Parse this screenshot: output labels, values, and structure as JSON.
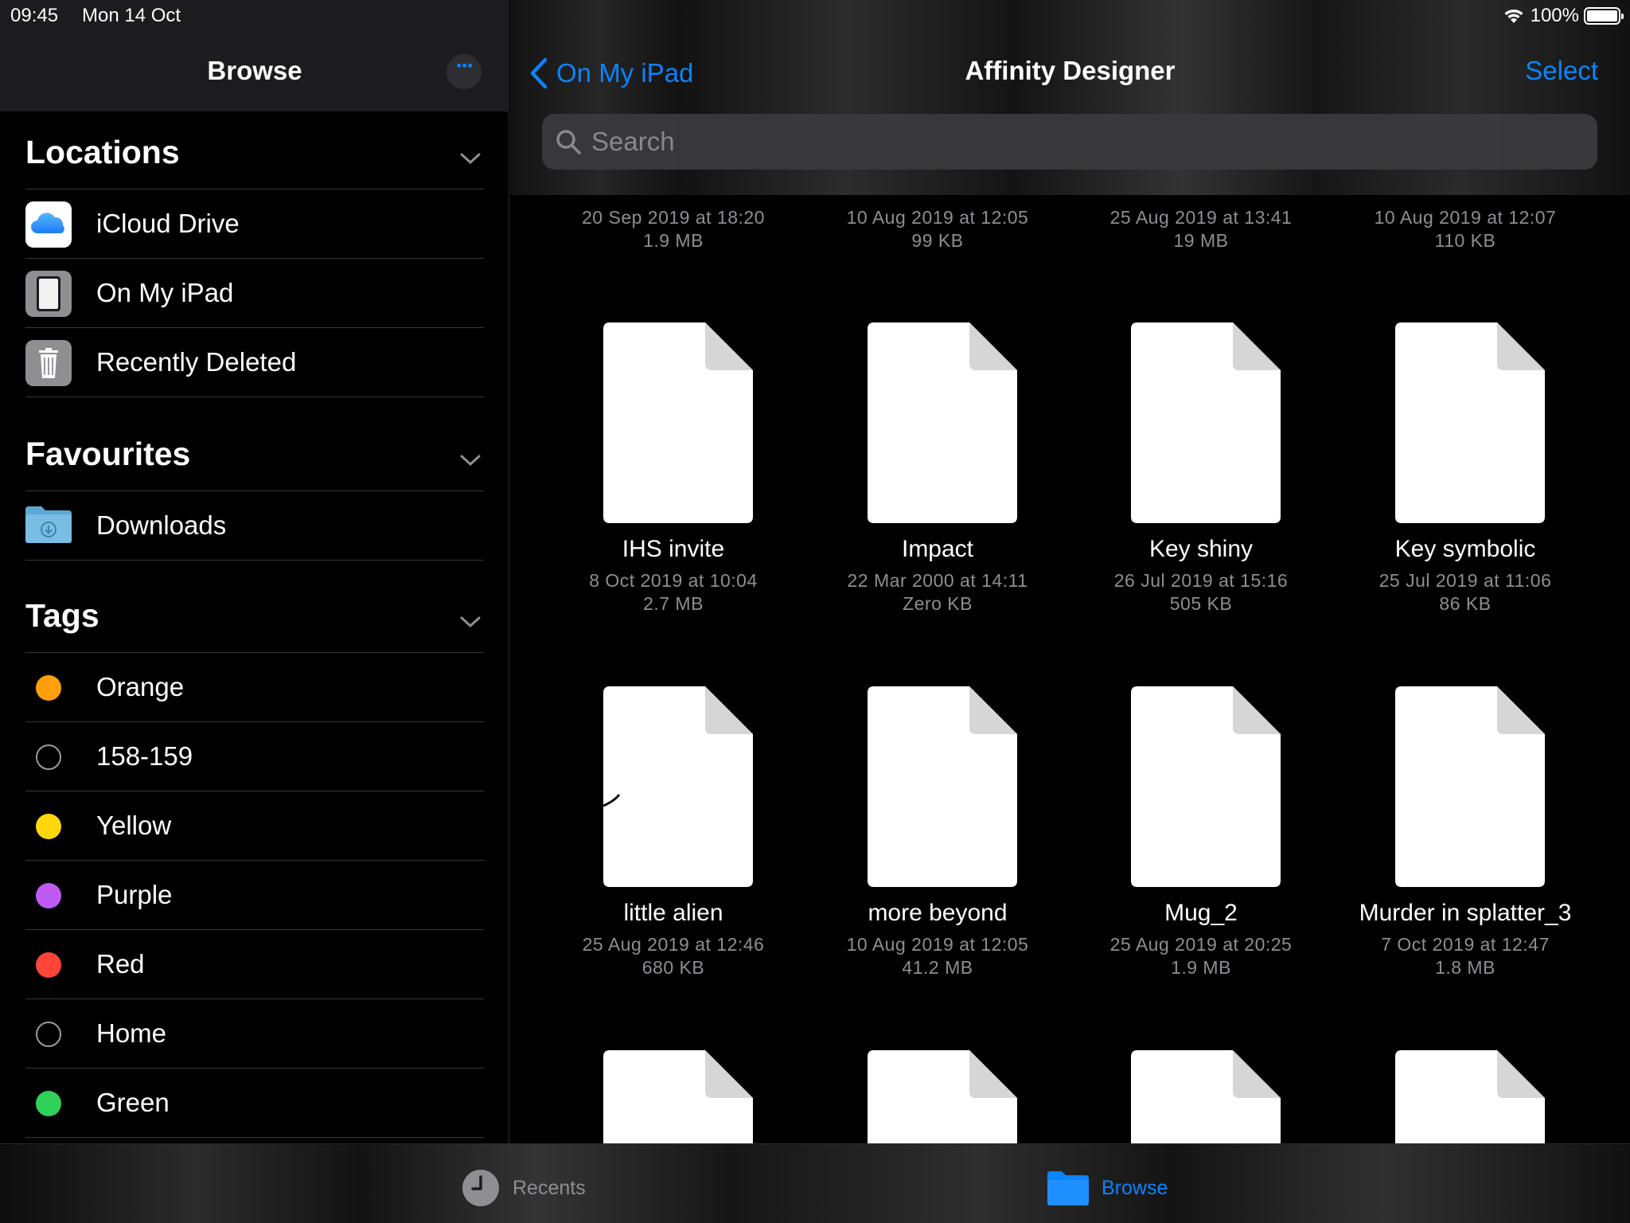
{
  "status_bar": {
    "time": "09:45",
    "date": "Mon 14 Oct",
    "battery": "100%"
  },
  "sidebar": {
    "title": "Browse",
    "sections": {
      "locations": {
        "title": "Locations",
        "items": [
          "iCloud Drive",
          "On My iPad",
          "Recently Deleted"
        ]
      },
      "favourites": {
        "title": "Favourites",
        "items": [
          "Downloads"
        ]
      },
      "tags": {
        "title": "Tags",
        "items": [
          {
            "label": "Orange",
            "color": "#ff9f0a"
          },
          {
            "label": "158-159",
            "color": "none"
          },
          {
            "label": "Yellow",
            "color": "#ffd60a"
          },
          {
            "label": "Purple",
            "color": "#bf5af2"
          },
          {
            "label": "Red",
            "color": "#ff453a"
          },
          {
            "label": "Home",
            "color": "none"
          },
          {
            "label": "Green",
            "color": "#30d158"
          }
        ]
      }
    }
  },
  "main": {
    "back_label": "On My iPad",
    "title": "Affinity Designer",
    "select_label": "Select",
    "search_placeholder": "Search",
    "files_row0": [
      {
        "date": "20 Sep 2019 at 18:20",
        "size": "1.9 MB"
      },
      {
        "date": "10 Aug 2019 at 12:05",
        "size": "99 KB"
      },
      {
        "date": "25 Aug 2019 at 13:41",
        "size": "19 MB"
      },
      {
        "date": "10 Aug 2019 at 12:07",
        "size": "110 KB"
      }
    ],
    "files_row1": [
      {
        "name": "IHS invite",
        "date": "8 Oct 2019 at 10:04",
        "size": "2.7 MB"
      },
      {
        "name": "Impact",
        "date": "22 Mar 2000 at 14:11",
        "size": "Zero KB"
      },
      {
        "name": "Key shiny",
        "date": "26 Jul 2019 at 15:16",
        "size": "505 KB"
      },
      {
        "name": "Key symbolic",
        "date": "25 Jul 2019 at 11:06",
        "size": "86 KB"
      }
    ],
    "files_row2": [
      {
        "name": "little alien",
        "date": "25 Aug 2019 at 12:46",
        "size": "680 KB"
      },
      {
        "name": "more beyond",
        "date": "10 Aug 2019 at 12:05",
        "size": "41.2 MB"
      },
      {
        "name": "Mug_2",
        "date": "25 Aug 2019 at 20:25",
        "size": "1.9 MB"
      },
      {
        "name": "Murder in splatter_3",
        "date": "7 Oct 2019 at 12:47",
        "size": "1.8 MB"
      }
    ]
  },
  "tab_bar": {
    "recents_label": "Recents",
    "browse_label": "Browse"
  },
  "colors": {
    "accent": "#0a84ff",
    "secondary_text": "#8e8e93",
    "separator": "#38383a"
  },
  "icons": [
    "wifi-icon",
    "battery-icon",
    "more-icon",
    "chevron-down-icon",
    "icloud-icon",
    "ipad-icon",
    "trash-icon",
    "downloads-folder-icon",
    "chevron-left-icon",
    "search-icon",
    "document-icon",
    "clock-icon",
    "folder-icon"
  ]
}
